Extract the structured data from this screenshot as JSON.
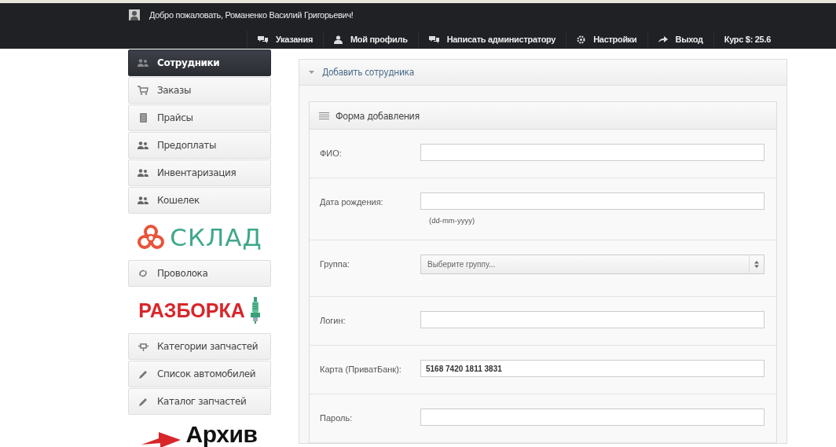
{
  "header": {
    "welcome": "Добро пожаловать, Романенко Василий Григорьевич!",
    "nav": [
      {
        "kind": "chat",
        "label": "Указания"
      },
      {
        "kind": "user",
        "label": "Мой профиль"
      },
      {
        "kind": "chat",
        "label": "Написать администратору"
      },
      {
        "kind": "gear",
        "label": "Настройки"
      },
      {
        "kind": "arrow",
        "label": "Выход"
      },
      {
        "kind": "rate",
        "label": "Курс $: 25.6"
      }
    ]
  },
  "sidebar": [
    {
      "kind": "menu",
      "items": [
        {
          "kind": "users",
          "label": "Сотрудники",
          "selected": true
        },
        {
          "kind": "cart",
          "label": "Заказы",
          "selected": false
        },
        {
          "kind": "doc",
          "label": "Прайсы",
          "selected": false
        },
        {
          "kind": "users",
          "label": "Предоплаты",
          "selected": false
        },
        {
          "kind": "users",
          "label": "Инвентаризация",
          "selected": false
        },
        {
          "kind": "users",
          "label": "Кошелек",
          "selected": false
        }
      ]
    },
    {
      "kind": "biohazard",
      "text": "СКЛАД"
    },
    {
      "kind": "menu",
      "items": [
        {
          "kind": "coil",
          "label": "Проволока",
          "selected": false
        }
      ]
    },
    {
      "kind": "sparkplug",
      "text": "РАЗБОРКА"
    },
    {
      "kind": "menu",
      "items": [
        {
          "kind": "part",
          "label": "Категории запчастей",
          "selected": false
        },
        {
          "kind": "pencil",
          "label": "Список автомобилей",
          "selected": false
        },
        {
          "kind": "pencil",
          "label": "Каталог запчастей",
          "selected": false
        }
      ]
    },
    {
      "kind": "redarrow",
      "text": "Архив"
    }
  ],
  "panel": {
    "title": "Добавить сотрудника",
    "expanded": true,
    "form": {
      "title": "Форма добавления",
      "fields": [
        {
          "kind": "text",
          "label": "ФИО:"
        },
        {
          "kind": "text",
          "label": "Дата рождения:",
          "hint": "(dd-mm-yyyy)"
        },
        {
          "kind": "select",
          "label": "Группа:",
          "placeholder": "Выберите группу..."
        },
        {
          "kind": "text",
          "label": "Логин:"
        },
        {
          "kind": "text",
          "label": "Карта (ПриватБанк):",
          "value": "5168 7420 1811 3831"
        },
        {
          "kind": "text",
          "label": "Пароль:"
        }
      ]
    }
  }
}
